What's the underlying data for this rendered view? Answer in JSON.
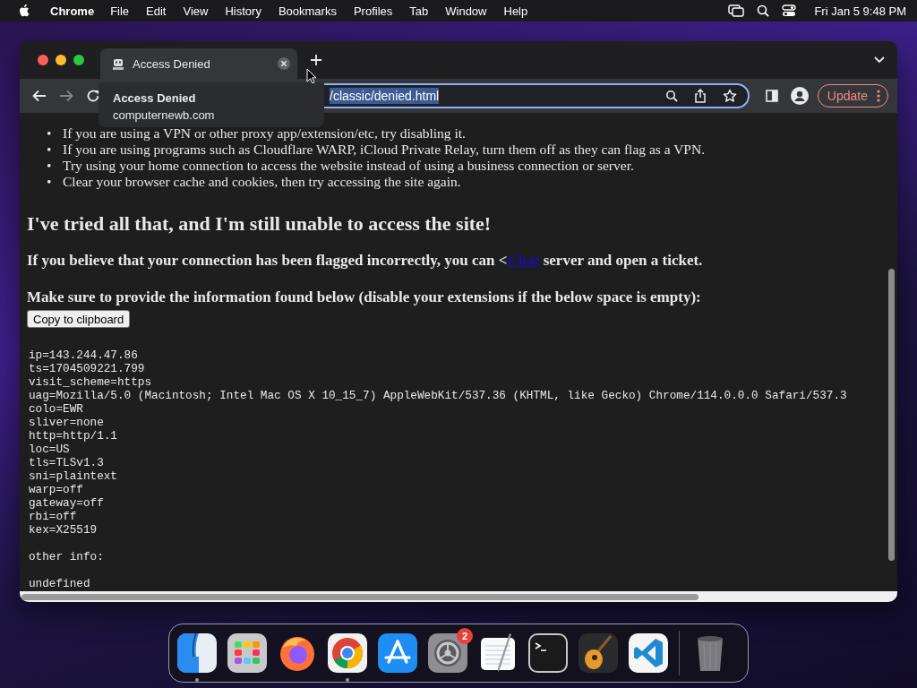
{
  "menubar": {
    "app": "Chrome",
    "menus": [
      "File",
      "Edit",
      "View",
      "History",
      "Bookmarks",
      "Profiles",
      "Tab",
      "Window",
      "Help"
    ],
    "clock": "Fri Jan 5  9:48 PM"
  },
  "browser": {
    "tab": {
      "title": "Access Denied",
      "selected": true
    },
    "tooltip": {
      "title": "Access Denied",
      "domain": "computernewb.com"
    },
    "address": "/classic/denied.html",
    "update_button": "Update"
  },
  "page": {
    "bullet_marker": "•",
    "bullets": [
      "If you are using a VPN or other proxy app/extension/etc, try disabling it.",
      "If you are using programs such as Cloudflare WARP, iCloud Private Relay, turn them off as they can flag as a VPN.",
      "Try using your home connection to access the website instead of using a business connection or server.",
      "Clear your browser cache and cookies, then try accessing the site again."
    ],
    "heading": "I've tried all that, and I'm still unable to access the site!",
    "ticket": {
      "before": "If you believe that your connection has been flagged incorrectly, you can <",
      "link": "Chat",
      "after": " server and open a ticket."
    },
    "instructions": "Make sure to provide the information found below (disable your extensions if the below space is empty):",
    "copy_button": "Copy to clipboard",
    "info_lines": [
      "ip=143.244.47.86",
      "ts=1704509221.799",
      "visit_scheme=https",
      "uag=Mozilla/5.0 (Macintosh; Intel Mac OS X 10_15_7) AppleWebKit/537.36 (KHTML, like Gecko) Chrome/114.0.0.0 Safari/537.3",
      "colo=EWR",
      "sliver=none",
      "http=http/1.1",
      "loc=US",
      "tls=TLSv1.3",
      "sni=plaintext",
      "warp=off",
      "gateway=off",
      "rbi=off",
      "kex=X25519"
    ],
    "other_label": "other info:",
    "other_value": "undefined"
  },
  "dock": {
    "items": [
      {
        "kind": "finder",
        "running": true
      },
      {
        "kind": "launchpad",
        "running": false
      },
      {
        "kind": "firefox",
        "running": false
      },
      {
        "kind": "chrome",
        "running": true
      },
      {
        "kind": "appstore",
        "running": false
      },
      {
        "kind": "settings",
        "running": false,
        "badge": "2"
      },
      {
        "kind": "textedit",
        "running": false
      },
      {
        "kind": "terminal",
        "running": false
      },
      {
        "kind": "garageband",
        "running": false
      },
      {
        "kind": "vscode",
        "running": false
      },
      {
        "kind": "separator"
      },
      {
        "kind": "trash",
        "running": false
      }
    ]
  }
}
